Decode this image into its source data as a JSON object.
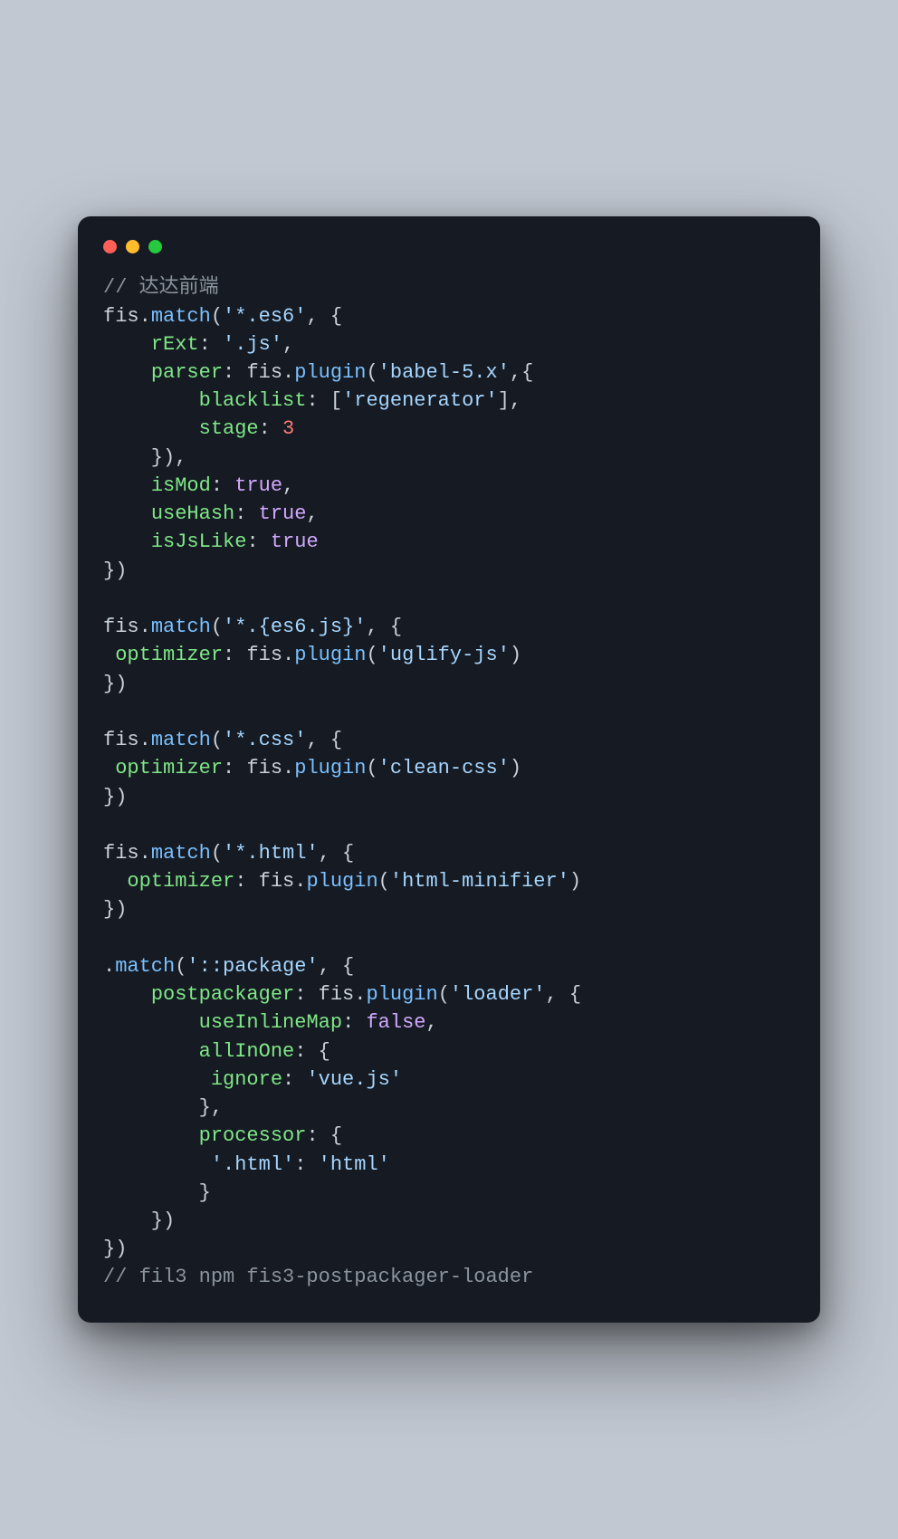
{
  "window": {
    "traffic_lights": [
      "close",
      "minimize",
      "zoom"
    ]
  },
  "code": {
    "tokens": [
      {
        "t": "comment",
        "v": "// 达达前端"
      },
      {
        "t": "nl"
      },
      {
        "t": "obj",
        "v": "fis"
      },
      {
        "t": "punc",
        "v": "."
      },
      {
        "t": "func",
        "v": "match"
      },
      {
        "t": "punc",
        "v": "("
      },
      {
        "t": "string",
        "v": "'*.es6'"
      },
      {
        "t": "punc",
        "v": ", {"
      },
      {
        "t": "nl"
      },
      {
        "t": "punc",
        "v": "    "
      },
      {
        "t": "prop",
        "v": "rExt"
      },
      {
        "t": "punc",
        "v": ": "
      },
      {
        "t": "string",
        "v": "'.js'"
      },
      {
        "t": "punc",
        "v": ","
      },
      {
        "t": "nl"
      },
      {
        "t": "punc",
        "v": "    "
      },
      {
        "t": "prop",
        "v": "parser"
      },
      {
        "t": "punc",
        "v": ": "
      },
      {
        "t": "obj",
        "v": "fis"
      },
      {
        "t": "punc",
        "v": "."
      },
      {
        "t": "func",
        "v": "plugin"
      },
      {
        "t": "punc",
        "v": "("
      },
      {
        "t": "string",
        "v": "'babel-5.x'"
      },
      {
        "t": "punc",
        "v": ",{"
      },
      {
        "t": "nl"
      },
      {
        "t": "punc",
        "v": "        "
      },
      {
        "t": "prop",
        "v": "blacklist"
      },
      {
        "t": "punc",
        "v": ": ["
      },
      {
        "t": "string",
        "v": "'regenerator'"
      },
      {
        "t": "punc",
        "v": "],"
      },
      {
        "t": "nl"
      },
      {
        "t": "punc",
        "v": "        "
      },
      {
        "t": "prop",
        "v": "stage"
      },
      {
        "t": "punc",
        "v": ": "
      },
      {
        "t": "num",
        "v": "3"
      },
      {
        "t": "nl"
      },
      {
        "t": "punc",
        "v": "    }),"
      },
      {
        "t": "nl"
      },
      {
        "t": "punc",
        "v": "    "
      },
      {
        "t": "prop",
        "v": "isMod"
      },
      {
        "t": "punc",
        "v": ": "
      },
      {
        "t": "bool",
        "v": "true"
      },
      {
        "t": "punc",
        "v": ","
      },
      {
        "t": "nl"
      },
      {
        "t": "punc",
        "v": "    "
      },
      {
        "t": "prop",
        "v": "useHash"
      },
      {
        "t": "punc",
        "v": ": "
      },
      {
        "t": "bool",
        "v": "true"
      },
      {
        "t": "punc",
        "v": ","
      },
      {
        "t": "nl"
      },
      {
        "t": "punc",
        "v": "    "
      },
      {
        "t": "prop",
        "v": "isJsLike"
      },
      {
        "t": "punc",
        "v": ": "
      },
      {
        "t": "bool",
        "v": "true"
      },
      {
        "t": "nl"
      },
      {
        "t": "punc",
        "v": "})"
      },
      {
        "t": "nl"
      },
      {
        "t": "nl"
      },
      {
        "t": "obj",
        "v": "fis"
      },
      {
        "t": "punc",
        "v": "."
      },
      {
        "t": "func",
        "v": "match"
      },
      {
        "t": "punc",
        "v": "("
      },
      {
        "t": "string",
        "v": "'*.{es6.js}'"
      },
      {
        "t": "punc",
        "v": ", {"
      },
      {
        "t": "nl"
      },
      {
        "t": "punc",
        "v": " "
      },
      {
        "t": "prop",
        "v": "optimizer"
      },
      {
        "t": "punc",
        "v": ": "
      },
      {
        "t": "obj",
        "v": "fis"
      },
      {
        "t": "punc",
        "v": "."
      },
      {
        "t": "func",
        "v": "plugin"
      },
      {
        "t": "punc",
        "v": "("
      },
      {
        "t": "string",
        "v": "'uglify-js'"
      },
      {
        "t": "punc",
        "v": ")"
      },
      {
        "t": "nl"
      },
      {
        "t": "punc",
        "v": "})"
      },
      {
        "t": "nl"
      },
      {
        "t": "nl"
      },
      {
        "t": "obj",
        "v": "fis"
      },
      {
        "t": "punc",
        "v": "."
      },
      {
        "t": "func",
        "v": "match"
      },
      {
        "t": "punc",
        "v": "("
      },
      {
        "t": "string",
        "v": "'*.css'"
      },
      {
        "t": "punc",
        "v": ", {"
      },
      {
        "t": "nl"
      },
      {
        "t": "punc",
        "v": " "
      },
      {
        "t": "prop",
        "v": "optimizer"
      },
      {
        "t": "punc",
        "v": ": "
      },
      {
        "t": "obj",
        "v": "fis"
      },
      {
        "t": "punc",
        "v": "."
      },
      {
        "t": "func",
        "v": "plugin"
      },
      {
        "t": "punc",
        "v": "("
      },
      {
        "t": "string",
        "v": "'clean-css'"
      },
      {
        "t": "punc",
        "v": ")"
      },
      {
        "t": "nl"
      },
      {
        "t": "punc",
        "v": "})"
      },
      {
        "t": "nl"
      },
      {
        "t": "nl"
      },
      {
        "t": "obj",
        "v": "fis"
      },
      {
        "t": "punc",
        "v": "."
      },
      {
        "t": "func",
        "v": "match"
      },
      {
        "t": "punc",
        "v": "("
      },
      {
        "t": "string",
        "v": "'*.html'"
      },
      {
        "t": "punc",
        "v": ", {"
      },
      {
        "t": "nl"
      },
      {
        "t": "punc",
        "v": "  "
      },
      {
        "t": "prop",
        "v": "optimizer"
      },
      {
        "t": "punc",
        "v": ": "
      },
      {
        "t": "obj",
        "v": "fis"
      },
      {
        "t": "punc",
        "v": "."
      },
      {
        "t": "func",
        "v": "plugin"
      },
      {
        "t": "punc",
        "v": "("
      },
      {
        "t": "string",
        "v": "'html-minifier'"
      },
      {
        "t": "punc",
        "v": ")"
      },
      {
        "t": "nl"
      },
      {
        "t": "punc",
        "v": "})"
      },
      {
        "t": "nl"
      },
      {
        "t": "nl"
      },
      {
        "t": "punc",
        "v": "."
      },
      {
        "t": "func",
        "v": "match"
      },
      {
        "t": "punc",
        "v": "("
      },
      {
        "t": "string",
        "v": "'::package'"
      },
      {
        "t": "punc",
        "v": ", {"
      },
      {
        "t": "nl"
      },
      {
        "t": "punc",
        "v": "    "
      },
      {
        "t": "prop",
        "v": "postpackager"
      },
      {
        "t": "punc",
        "v": ": "
      },
      {
        "t": "obj",
        "v": "fis"
      },
      {
        "t": "punc",
        "v": "."
      },
      {
        "t": "func",
        "v": "plugin"
      },
      {
        "t": "punc",
        "v": "("
      },
      {
        "t": "string",
        "v": "'loader'"
      },
      {
        "t": "punc",
        "v": ", {"
      },
      {
        "t": "nl"
      },
      {
        "t": "punc",
        "v": "        "
      },
      {
        "t": "prop",
        "v": "useInlineMap"
      },
      {
        "t": "punc",
        "v": ": "
      },
      {
        "t": "bool",
        "v": "false"
      },
      {
        "t": "punc",
        "v": ","
      },
      {
        "t": "nl"
      },
      {
        "t": "punc",
        "v": "        "
      },
      {
        "t": "prop",
        "v": "allInOne"
      },
      {
        "t": "punc",
        "v": ": {"
      },
      {
        "t": "nl"
      },
      {
        "t": "punc",
        "v": "         "
      },
      {
        "t": "prop",
        "v": "ignore"
      },
      {
        "t": "punc",
        "v": ": "
      },
      {
        "t": "string",
        "v": "'vue.js'"
      },
      {
        "t": "nl"
      },
      {
        "t": "punc",
        "v": "        },"
      },
      {
        "t": "nl"
      },
      {
        "t": "punc",
        "v": "        "
      },
      {
        "t": "prop",
        "v": "processor"
      },
      {
        "t": "punc",
        "v": ": {"
      },
      {
        "t": "nl"
      },
      {
        "t": "punc",
        "v": "         "
      },
      {
        "t": "string",
        "v": "'.html'"
      },
      {
        "t": "punc",
        "v": ": "
      },
      {
        "t": "string",
        "v": "'html'"
      },
      {
        "t": "nl"
      },
      {
        "t": "punc",
        "v": "        }"
      },
      {
        "t": "nl"
      },
      {
        "t": "punc",
        "v": "    })"
      },
      {
        "t": "nl"
      },
      {
        "t": "punc",
        "v": "})"
      },
      {
        "t": "nl"
      },
      {
        "t": "comment",
        "v": "// fil3 npm fis3-postpackager-loader"
      }
    ]
  }
}
